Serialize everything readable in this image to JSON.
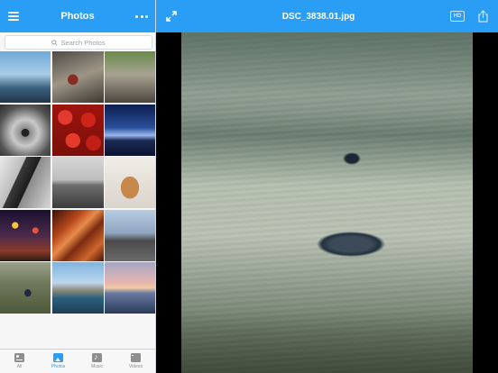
{
  "sidebar": {
    "title": "Photos",
    "search_placeholder": "Search Photos",
    "thumbnails": [
      {
        "name": "harbor-sailboats"
      },
      {
        "name": "vintage-camera"
      },
      {
        "name": "stone-wall"
      },
      {
        "name": "bw-spiral"
      },
      {
        "name": "red-apples"
      },
      {
        "name": "night-bridge"
      },
      {
        "name": "bw-bridge-underside"
      },
      {
        "name": "bw-coastline"
      },
      {
        "name": "puppy"
      },
      {
        "name": "city-lights"
      },
      {
        "name": "antelope-canyon"
      },
      {
        "name": "bare-trees"
      },
      {
        "name": "sand-pebble"
      },
      {
        "name": "lake-castle"
      },
      {
        "name": "sunset-water"
      }
    ],
    "tabs": [
      {
        "label": "All",
        "icon": "all-icon",
        "active": false
      },
      {
        "label": "Photos",
        "icon": "photos-icon",
        "active": true
      },
      {
        "label": "Music",
        "icon": "music-icon",
        "active": false
      },
      {
        "label": "Videos",
        "icon": "videos-icon",
        "active": false
      }
    ]
  },
  "viewer": {
    "file_title": "DSC_3838.01.jpg",
    "hd_label": "HD",
    "image_description_icon": "sand-pebble"
  },
  "colors": {
    "accent": "#2a9df4",
    "sidebar_bg": "#f6f6f6",
    "viewer_bg": "#000000"
  }
}
